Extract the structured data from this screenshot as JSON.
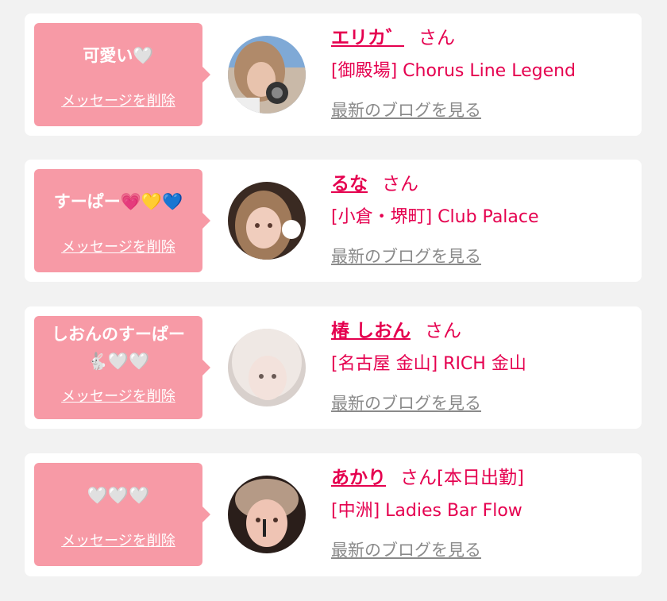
{
  "colors": {
    "accent": "#e5004f",
    "bubble": "#f79aa6",
    "muted": "#8a8a8a"
  },
  "cards": [
    {
      "message": "可愛い🤍",
      "delete_label": "メッセージを削除",
      "name": "エリカ゛",
      "honorific": "さん",
      "status": "",
      "shop": "[御殿場] Chorus Line Legend",
      "blog_link": "最新のブログを見る"
    },
    {
      "message": "すーぱー💗💛💙",
      "delete_label": "メッセージを削除",
      "name": "るな",
      "honorific": "さん",
      "status": "",
      "shop": "[小倉・堺町] Club Palace",
      "blog_link": "最新のブログを見る"
    },
    {
      "message_line1": "しおんのすーぱー",
      "message_line2": "🐇🤍🤍",
      "delete_label": "メッセージを削除",
      "name": "椿 しおん",
      "honorific": "さん",
      "status": "",
      "shop": "[名古屋 金山] RICH 金山",
      "blog_link": "最新のブログを見る"
    },
    {
      "message": "🤍🤍🤍",
      "delete_label": "メッセージを削除",
      "name": "あかり",
      "honorific": "さん",
      "status": "[本日出勤]",
      "shop": "[中洲] Ladies Bar Flow",
      "blog_link": "最新のブログを見る"
    }
  ]
}
